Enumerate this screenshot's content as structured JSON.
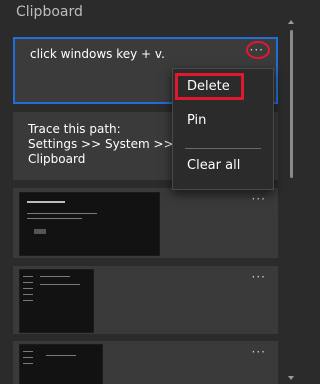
{
  "header": {
    "title": "Clipboard"
  },
  "items": [
    {
      "text": "click windows key + v.",
      "more_label": "···",
      "selected": true
    },
    {
      "text": "Trace this path:\nSettings >> System >> scro\nClipboard",
      "more_label": "···"
    },
    {
      "more_label": "···",
      "image_kind": "screenshot"
    },
    {
      "more_label": "···",
      "image_kind": "screenshot"
    },
    {
      "more_label": "···",
      "image_kind": "screenshot"
    }
  ],
  "context_menu": {
    "delete_label": "Delete",
    "pin_label": "Pin",
    "clear_all_label": "Clear all"
  },
  "colors": {
    "background": "#2b2b2b",
    "card": "#3a3a3a",
    "selection_border": "#1e6fd9",
    "annotation_red": "#e0192f"
  },
  "icons": {
    "more": "more-options-icon",
    "scroll_up": "scroll-up-icon",
    "scroll_down": "scroll-down-icon"
  }
}
